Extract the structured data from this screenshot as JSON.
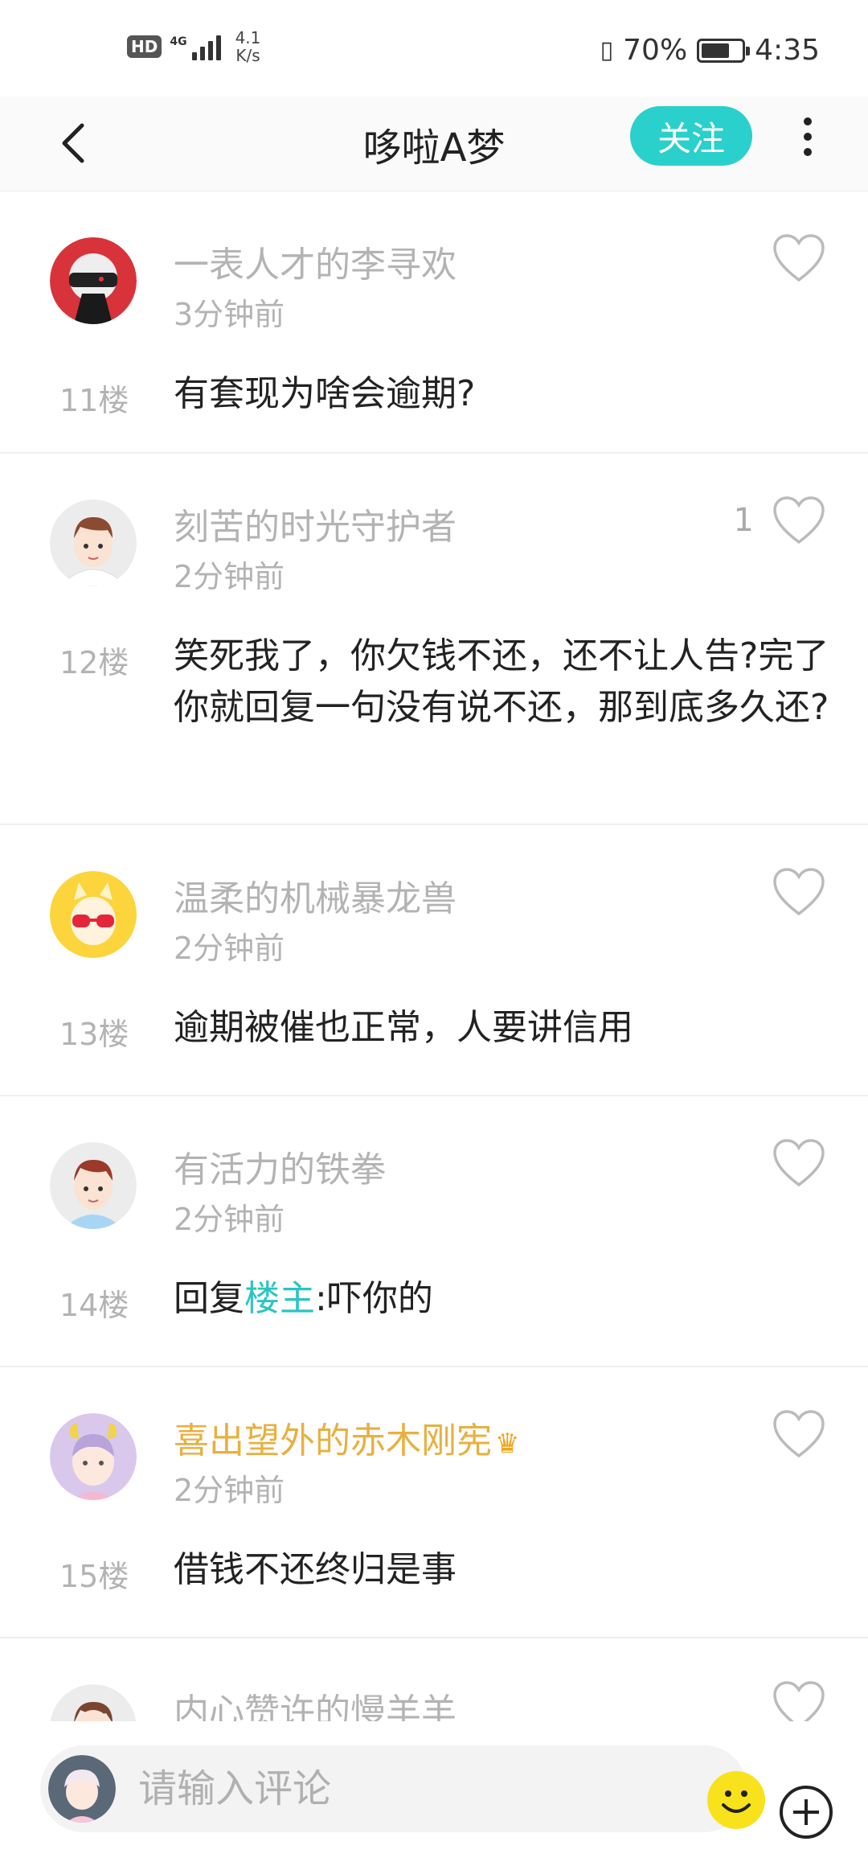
{
  "status_bar": {
    "hd": "HD",
    "network": "4G",
    "speed_value": "4.1",
    "speed_unit": "K/s",
    "battery_percent": "70%",
    "battery_level": 0.7,
    "time": "4:35",
    "vibrate_icon": "vibrate-icon"
  },
  "header": {
    "title": "哆啦A梦",
    "follow_label": "关注"
  },
  "comments": [
    {
      "username": "一表人才的李寻欢",
      "time": "3分钟前",
      "floor": "11楼",
      "text": "有套现为啥会逾期?",
      "likes": ""
    },
    {
      "username": "刻苦的时光守护者",
      "time": "2分钟前",
      "floor": "12楼",
      "text": "笑死我了，你欠钱不还，还不让人告?完了你就回复一句没有说不还，那到底多久还?",
      "likes": "1"
    },
    {
      "username": "温柔的机械暴龙兽",
      "time": "2分钟前",
      "floor": "13楼",
      "text": "逾期被催也正常，人要讲信用",
      "likes": ""
    },
    {
      "username": "有活力的铁拳",
      "time": "2分钟前",
      "floor": "14楼",
      "text_prefix": "回复",
      "mention": "楼主",
      "text_suffix": ":吓你的",
      "likes": ""
    },
    {
      "username": "喜出望外的赤木刚宪",
      "time": "2分钟前",
      "floor": "15楼",
      "text": "借钱不还终归是事",
      "likes": ""
    },
    {
      "username": "内心赞许的慢羊羊",
      "time": "",
      "floor": "",
      "text": "",
      "likes": ""
    }
  ],
  "input_bar": {
    "placeholder": "请输入评论"
  },
  "colors": {
    "accent": "#2ad0cb",
    "mention": "#2ac5c1",
    "vip_name": "#e8b03f",
    "muted": "#b3b3b3"
  }
}
